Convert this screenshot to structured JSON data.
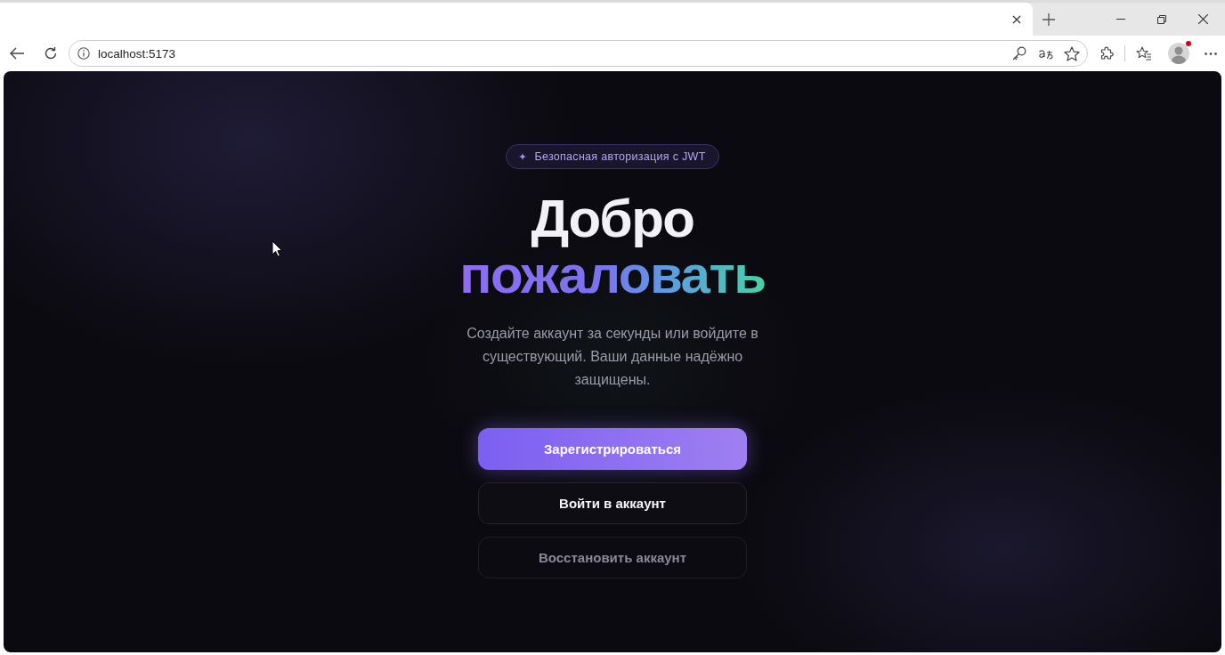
{
  "browser": {
    "address": "localhost:5173",
    "profile": {
      "notification": true
    }
  },
  "hero": {
    "badge": "Безопасная авторизация с JWT",
    "title_lines": [
      {
        "text": "Добро",
        "kind": "plain"
      },
      {
        "text": "пожаловать",
        "kind": "gradient"
      }
    ],
    "description": "Создайте аккаунт за секунды или войдите в существующий. Ваши данные надёжно защищены.",
    "buttons": [
      {
        "label": "Зарегистрироваться",
        "kind": "primary"
      },
      {
        "label": "Войти в аккаунт",
        "kind": "secondary"
      },
      {
        "label": "Восстановить аккаунт",
        "kind": "muted"
      }
    ]
  }
}
